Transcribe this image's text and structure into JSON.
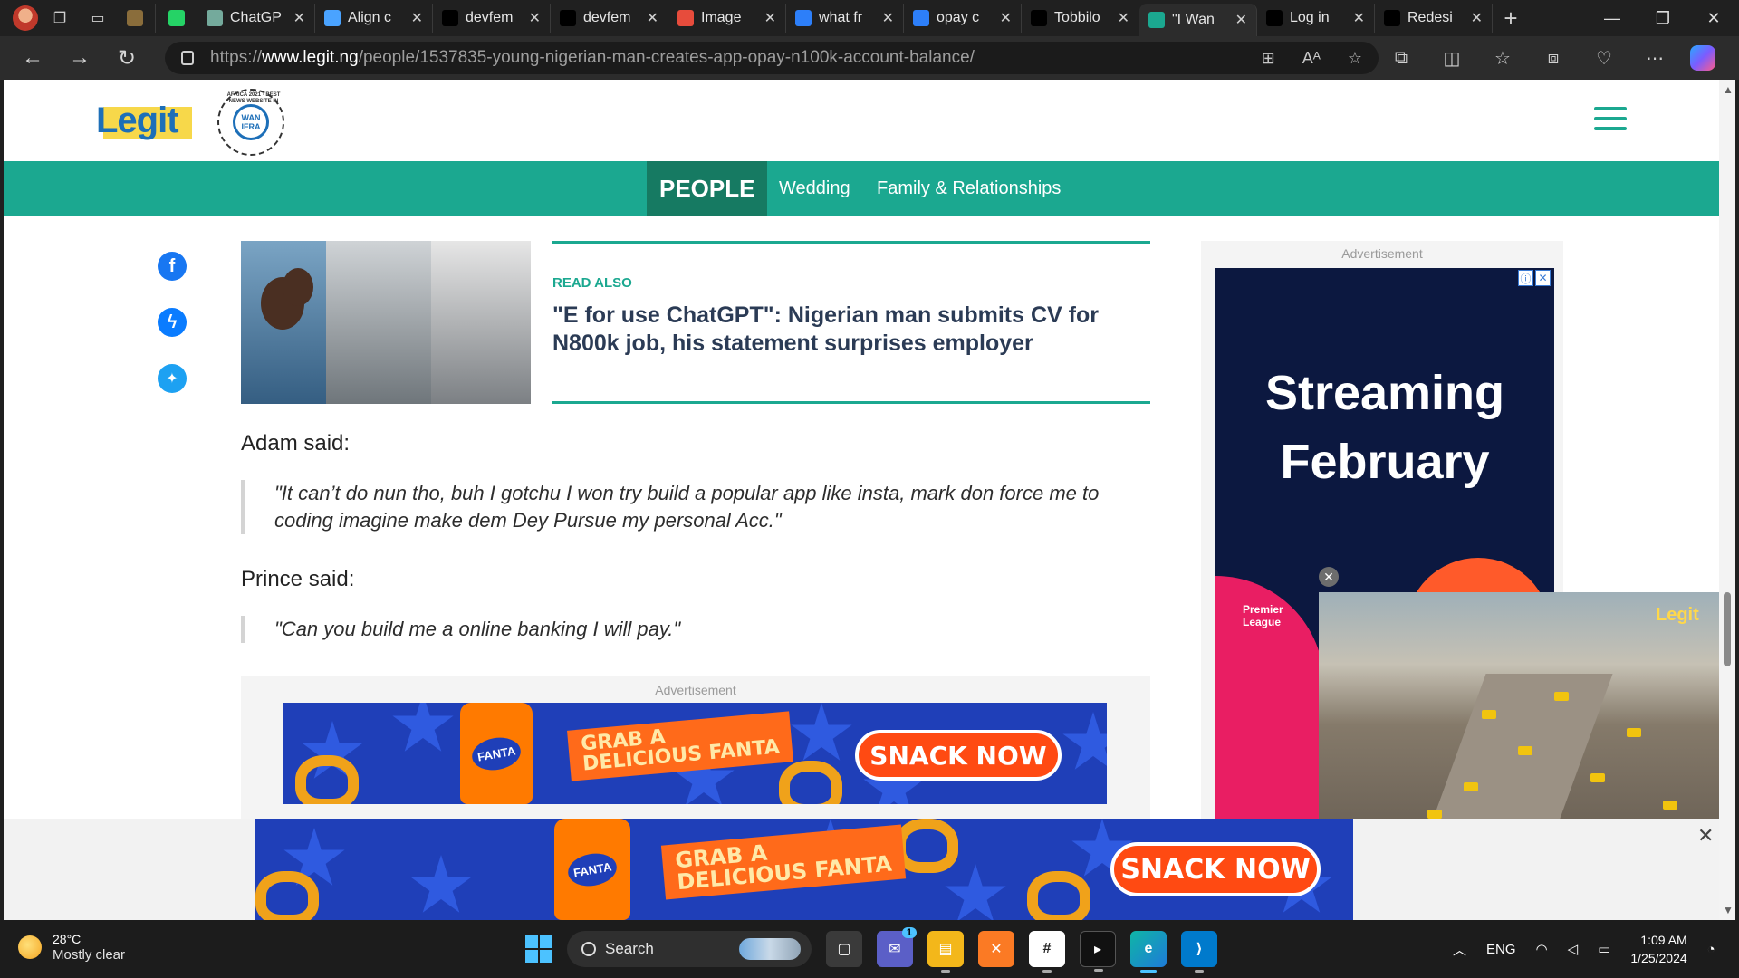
{
  "browser": {
    "tabs": [
      {
        "title": "",
        "favicon": "ext-icon",
        "color": "#8a6d3b"
      },
      {
        "title": "",
        "favicon": "whatsapp-icon",
        "color": "#25d366"
      },
      {
        "title": "ChatGP",
        "favicon": "chatgpt-icon",
        "color": "#74aa9c"
      },
      {
        "title": "Align c",
        "favicon": "align-icon",
        "color": "#4aa3ff"
      },
      {
        "title": "devfem",
        "favicon": "github-icon",
        "color": "#000000"
      },
      {
        "title": "devfem",
        "favicon": "github-icon",
        "color": "#000000"
      },
      {
        "title": "Image",
        "favicon": "pen-icon",
        "color": "#e74c3c"
      },
      {
        "title": "what fr",
        "favicon": "bing-search-icon",
        "color": "#2d7ff9"
      },
      {
        "title": "opay c",
        "favicon": "bing-search-icon",
        "color": "#2d7ff9"
      },
      {
        "title": "Tobbilo",
        "favicon": "github-icon",
        "color": "#000000"
      },
      {
        "title": "\"I Wan",
        "favicon": "legit-icon",
        "color": "#1ba890",
        "active": true
      },
      {
        "title": "Log in",
        "favicon": "tiktok-icon",
        "color": "#000000"
      },
      {
        "title": "Redesi",
        "favicon": "medium-icon",
        "color": "#000000"
      }
    ],
    "url_prefix": "https://",
    "url_host": "www.legit.ng",
    "url_path": "/people/1537835-young-nigerian-man-creates-app-opay-n100k-account-balance/"
  },
  "site": {
    "logo_text": "Legit",
    "award_ring": "AFRICA 2021 · BEST NEWS WEBSITE IN",
    "award_inner": "WAN IFRA",
    "category_main": "PEOPLE",
    "category_links": [
      "Wedding",
      "Family & Relationships"
    ]
  },
  "article": {
    "read_also_label": "READ ALSO",
    "read_also_title": "\"E for use ChatGPT\": Nigerian man submits CV for N800k job, his statement surprises employer",
    "comments": [
      {
        "author": "Adam said:",
        "quote": "\"It can’t do nun tho, buh I gotchu I won try build a popular app like insta, mark don force me to coding imagine make dem Dey Pursue my personal Acc.\""
      },
      {
        "author": "Prince said:",
        "quote": "\"Can you build me a online banking I will pay.\""
      }
    ]
  },
  "ads": {
    "label": "Advertisement",
    "fanta_brand": "FANTA",
    "fanta_slogan_line1": "GRAB A",
    "fanta_slogan_line2": "DELICIOUS FANTA",
    "fanta_cta": "SNACK NOW",
    "side_headline_line1": "Streaming",
    "side_headline_line2": "February",
    "side_badge": "Premier League",
    "video_logo": "Legit"
  },
  "taskbar": {
    "temperature": "28°C",
    "condition": "Mostly clear",
    "search_label": "Search",
    "language": "ENG",
    "time": "1:09 AM",
    "date": "1/25/2024",
    "teams_badge": "1"
  }
}
